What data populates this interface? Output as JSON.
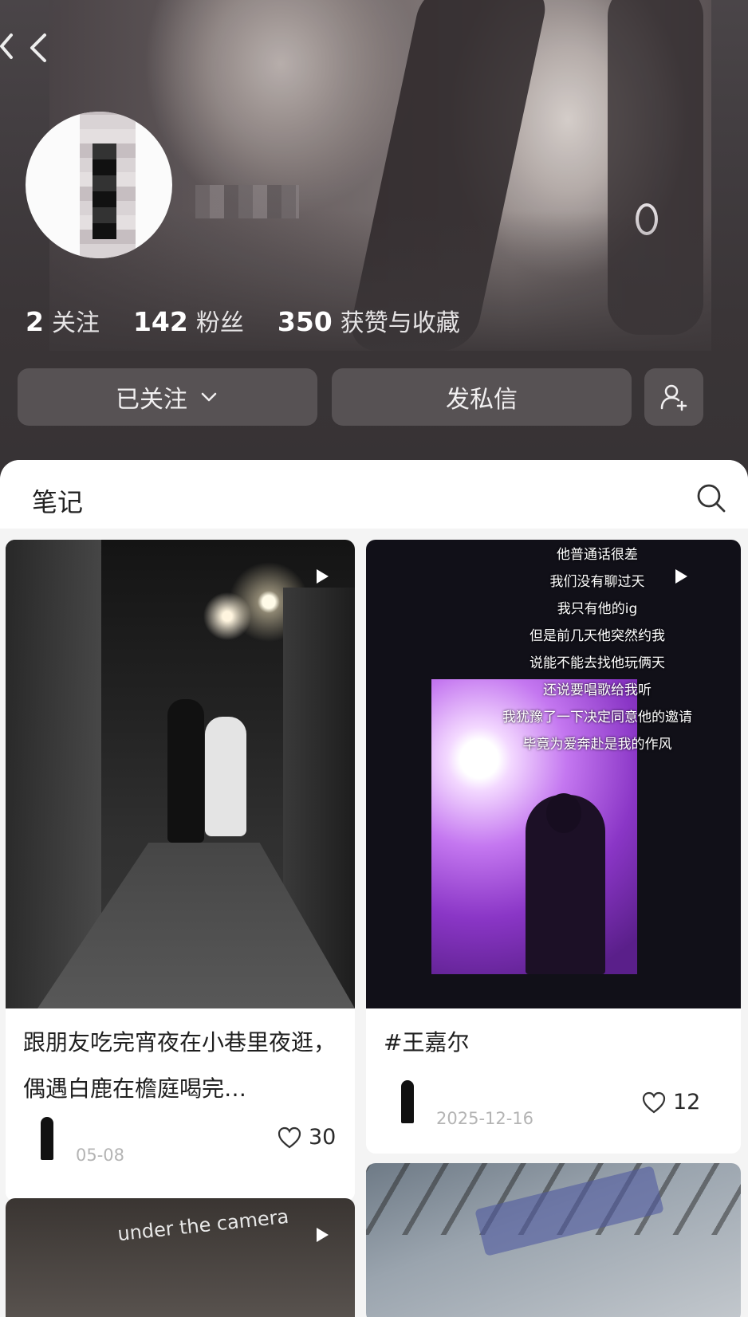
{
  "profile": {
    "stats": [
      {
        "num": "2",
        "label": "关注"
      },
      {
        "num": "142",
        "label": "粉丝"
      },
      {
        "num": "350",
        "label": "获赞与收藏"
      }
    ]
  },
  "actions": {
    "follow_label": "已关注",
    "message_label": "发私信"
  },
  "notes": {
    "tab_label": "笔记",
    "cards": [
      {
        "title": "跟朋友吃完宵夜在小巷里夜逛，偶遇白鹿在檐庭喝完…",
        "date": "05-08",
        "likes": "30",
        "is_video": true
      },
      {
        "title": "#王嘉尔",
        "date": "2025-12-16",
        "likes": "12",
        "is_video": true,
        "overlay_lines": [
          "他普通话很差",
          "我们没有聊过天",
          "我只有他的ig",
          "但是前几天他突然约我",
          "说能不能去找他玩俩天",
          "还说要唱歌给我听",
          "我犹豫了一下决定同意他的邀请",
          "毕竟为爱奔赴是我的作风"
        ]
      },
      {
        "caption": "under the camera",
        "is_video": true
      },
      {
        "is_video": false
      }
    ]
  },
  "icons": {
    "back": "chevron-left-icon",
    "dropdown": "chevron-down-icon",
    "add_friend": "add-user-icon",
    "search": "search-icon",
    "play": "play-icon",
    "like": "heart-icon"
  }
}
